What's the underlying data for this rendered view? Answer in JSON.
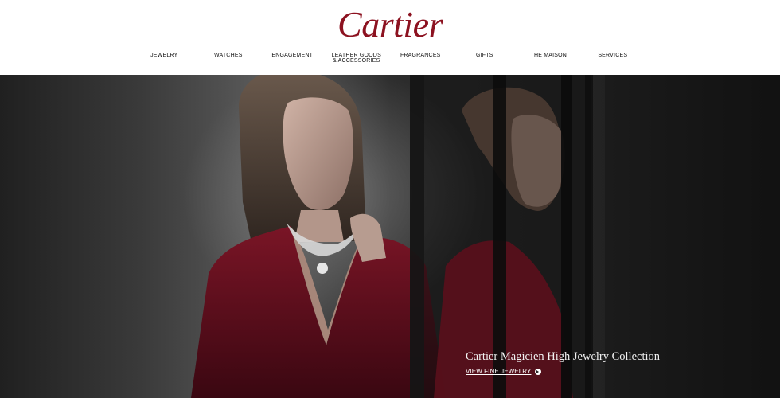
{
  "header": {
    "logo_text": "Cartier"
  },
  "nav": {
    "items": [
      {
        "label": "JEWELRY"
      },
      {
        "label": "WATCHES"
      },
      {
        "label": "ENGAGEMENT"
      },
      {
        "label": "LEATHER GOODS\n& ACCESSORIES"
      },
      {
        "label": "FRAGRANCES"
      },
      {
        "label": "GIFTS"
      },
      {
        "label": "THE MAISON"
      },
      {
        "label": "SERVICES"
      }
    ]
  },
  "hero": {
    "title": "Cartier Magicien High Jewelry Collection",
    "link_text": "VIEW FINE JEWELRY",
    "icon": "arrow-right-circle-icon"
  },
  "colors": {
    "brand": "#8c1220",
    "nav_text": "#111111",
    "hero_bg": "#2a2a2a"
  }
}
